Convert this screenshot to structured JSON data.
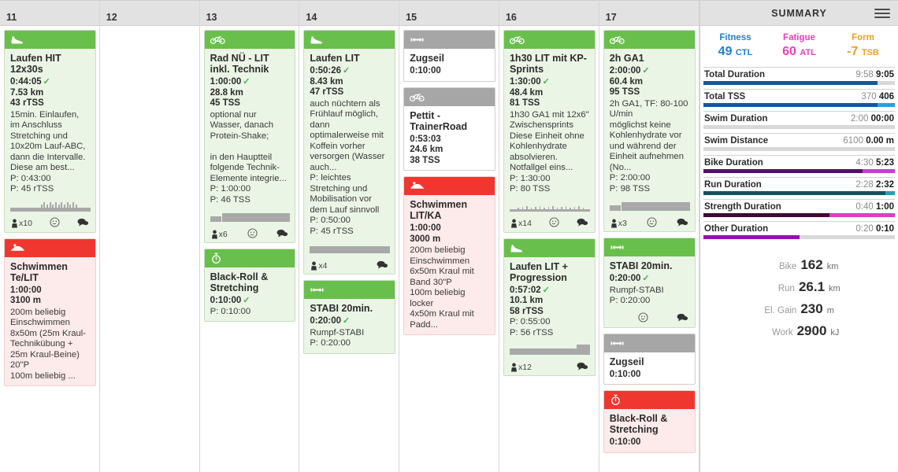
{
  "calendar": {
    "days": [
      {
        "label": "11",
        "cards": [
          {
            "icon": "running-shoe-icon",
            "color": "green",
            "title": "Laufen HIT 12x30s",
            "duration": "0:44:05",
            "completed": true,
            "distance": "7.53 km",
            "tss": "43 rTSS",
            "desc": "15min. Einlaufen, im Anschluss Stretching und 10x20m Lauf-ABC, dann die Intervalle. Diese am best...",
            "plan": [
              "P: 0:43:00",
              "P: 45 rTSS"
            ],
            "graph": "spikes",
            "foot": {
              "laps": "x10",
              "mood": true,
              "comment": true
            }
          },
          {
            "icon": "swim-icon",
            "color": "red",
            "title": "Schwimmen Te/LIT",
            "duration": "1:00:00",
            "completed": false,
            "distance": "3100 m",
            "tss": "",
            "desc": "200m beliebig Einschwimmen\n8x50m (25m Kraul-Technikübung + 25m Kraul-Beine) 20\"P\n100m beliebig ...",
            "plan": [],
            "graph": "",
            "foot": null
          }
        ]
      },
      {
        "label": "12",
        "cards": []
      },
      {
        "label": "13",
        "cards": [
          {
            "icon": "bike-icon",
            "color": "green",
            "title": "Rad NÜ - LIT inkl. Technik",
            "duration": "1:00:00",
            "completed": true,
            "distance": "28.8 km",
            "tss": "45 TSS",
            "desc": "optional nur Wasser, danach Protein-Shake;\n\nin den Hauptteil folgende Technik-Elemente integrie...",
            "plan": [
              "P: 1:00:00",
              "P: 46 TSS"
            ],
            "graph": "blocks",
            "foot": {
              "laps": "x6",
              "mood": true,
              "comment": true
            }
          },
          {
            "icon": "stopwatch-icon",
            "color": "green",
            "title": "Black-Roll & Stretching",
            "duration": "0:10:00",
            "completed": true,
            "distance": "",
            "tss": "",
            "desc": "",
            "plan": [
              "P: 0:10:00"
            ],
            "graph": "",
            "foot": null
          }
        ]
      },
      {
        "label": "14",
        "cards": [
          {
            "icon": "running-shoe-icon",
            "color": "green",
            "title": "Laufen LIT",
            "duration": "0:50:26",
            "completed": true,
            "distance": "8.43 km",
            "tss": "47 rTSS",
            "desc": "auch nüchtern als Frühlauf möglich, dann optimalerweise mit Koffein vorher versorgen (Wasser auch...",
            "plan": [
              "P: leichtes Stretching und Mobilisation vor dem Lauf sinnvoll",
              "P: 0:50:00",
              "P: 45 rTSS"
            ],
            "graph": "flat",
            "foot": {
              "laps": "x4",
              "mood": false,
              "comment": true
            }
          },
          {
            "icon": "stabi-icon",
            "color": "green",
            "title": "STABI 20min.",
            "duration": "0:20:00",
            "completed": true,
            "distance": "",
            "tss": "",
            "desc": "Rumpf-STABI",
            "plan": [
              "P: 0:20:00"
            ],
            "graph": "",
            "foot": null
          }
        ]
      },
      {
        "label": "15",
        "cards": [
          {
            "icon": "stabi-icon",
            "color": "gray",
            "title": "Zugseil",
            "duration": "0:10:00",
            "completed": false,
            "distance": "",
            "tss": "",
            "desc": "",
            "plan": [],
            "graph": "",
            "foot": null
          },
          {
            "icon": "bike-icon",
            "color": "gray",
            "title": "Pettit - TrainerRoad",
            "duration": "0:53:03",
            "completed": false,
            "distance": "24.6 km",
            "tss": "38 TSS",
            "desc": "",
            "plan": [],
            "graph": "",
            "foot": null
          },
          {
            "icon": "swim-icon",
            "color": "red",
            "title": "Schwimmen LIT/KA",
            "duration": "1:00:00",
            "completed": false,
            "distance": "3000 m",
            "tss": "",
            "desc": "200m beliebig Einschwimmen\n6x50m Kraul mit Band 30\"P\n100m beliebig locker\n4x50m Kraul mit Padd...",
            "plan": [],
            "graph": "",
            "foot": null
          }
        ]
      },
      {
        "label": "16",
        "cards": [
          {
            "icon": "bike-icon",
            "color": "green",
            "title": "1h30 LIT mit KP-Sprints",
            "duration": "1:30:00",
            "completed": true,
            "distance": "48.4 km",
            "tss": "81 TSS",
            "desc": "1h30 GA1 mit 12x6\" Zwischensprints\nDiese Einheit ohne Kohlenhydrate absolvieren. Notfallgel eins...",
            "plan": [
              "P: 1:30:00",
              "P: 80 TSS"
            ],
            "graph": "lowspikes",
            "foot": {
              "laps": "x14",
              "mood": true,
              "comment": true
            }
          },
          {
            "icon": "running-shoe-icon",
            "color": "green",
            "title": "Laufen LIT + Progression",
            "duration": "0:57:02",
            "completed": true,
            "distance": "10.1 km",
            "tss": "58 rTSS",
            "desc": "",
            "plan": [
              "P: 0:55:00",
              "P: 56 rTSS"
            ],
            "graph": "step",
            "foot": {
              "laps": "x12",
              "mood": false,
              "comment": true
            }
          }
        ]
      },
      {
        "label": "17",
        "cards": [
          {
            "icon": "bike-icon",
            "color": "green",
            "title": "2h GA1",
            "duration": "2:00:00",
            "completed": true,
            "distance": "60.4 km",
            "tss": "95 TSS",
            "desc": "2h GA1, TF: 80-100 U/min\nmöglichst keine Kohlenhydrate vor und während der Einheit aufnehmen (No...",
            "plan": [
              "P: 2:00:00",
              "P: 98 TSS"
            ],
            "graph": "blocks",
            "foot": {
              "laps": "x3",
              "mood": true,
              "comment": true
            }
          },
          {
            "icon": "stabi-icon",
            "color": "green",
            "title": "STABI 20min.",
            "duration": "0:20:00",
            "completed": true,
            "distance": "",
            "tss": "",
            "desc": "Rumpf-STABI",
            "plan": [
              "P: 0:20:00"
            ],
            "graph": "",
            "foot": {
              "laps": "",
              "mood": true,
              "comment": true
            }
          },
          {
            "icon": "stabi-icon",
            "color": "gray",
            "title": "Zugseil",
            "duration": "0:10:00",
            "completed": false,
            "distance": "",
            "tss": "",
            "desc": "",
            "plan": [],
            "graph": "",
            "foot": null
          },
          {
            "icon": "stopwatch-icon",
            "color": "red",
            "title": "Black-Roll & Stretching",
            "duration": "0:10:00",
            "completed": false,
            "distance": "",
            "tss": "",
            "desc": "",
            "plan": [],
            "graph": "",
            "foot": null
          }
        ]
      }
    ]
  },
  "summary": {
    "title": "SUMMARY",
    "menu_icon": "hamburger-icon",
    "pmc": [
      {
        "name": "Fitness",
        "value": "49",
        "unit": "CTL",
        "color": "#1f7fd4"
      },
      {
        "name": "Fatigue",
        "value": "60",
        "unit": "ATL",
        "color": "#ec3fc0"
      },
      {
        "name": "Form",
        "value": "-7",
        "unit": "TSB",
        "color": "#f0a01e"
      }
    ],
    "stats": [
      {
        "label": "Total Duration",
        "planned": "9:58",
        "actual": "9:05",
        "unit": "",
        "fill": 91,
        "fill2": 0,
        "color": "#13589e",
        "color2": "#d8d8d8"
      },
      {
        "label": "Total TSS",
        "planned": "370",
        "actual": "406",
        "unit": "",
        "fill": 91,
        "fill2": 9,
        "color": "#13589e",
        "color2": "#2f9ede"
      },
      {
        "label": "Swim Duration",
        "planned": "2:00",
        "actual": "00:00",
        "unit": "",
        "fill": 0,
        "fill2": 0,
        "color": "#bdbdbd",
        "color2": "#d8d8d8"
      },
      {
        "label": "Swim Distance",
        "planned": "6100",
        "actual": "0.00 m",
        "unit": "",
        "fill": 0,
        "fill2": 0,
        "color": "#bdbdbd",
        "color2": "#d8d8d8"
      },
      {
        "label": "Bike Duration",
        "planned": "4:30",
        "actual": "5:23",
        "unit": "",
        "fill": 83,
        "fill2": 17,
        "color": "#51106b",
        "color2": "#c13fd6"
      },
      {
        "label": "Run Duration",
        "planned": "2:28",
        "actual": "2:32",
        "unit": "",
        "fill": 95,
        "fill2": 5,
        "color": "#16515e",
        "color2": "#2a9fb5"
      },
      {
        "label": "Strength Duration",
        "planned": "0:40",
        "actual": "1:00",
        "unit": "",
        "fill": 66,
        "fill2": 34,
        "color": "#3d0b33",
        "color2": "#e03ec0"
      },
      {
        "label": "Other Duration",
        "planned": "0:20",
        "actual": "0:10",
        "unit": "",
        "fill": 50,
        "fill2": 0,
        "color": "#9510b5",
        "color2": "#d8d8d8"
      }
    ],
    "totals": [
      {
        "label": "Bike",
        "value": "162",
        "unit": "km"
      },
      {
        "label": "Run",
        "value": "26.1",
        "unit": "km"
      },
      {
        "label": "El. Gain",
        "value": "230",
        "unit": "m"
      },
      {
        "label": "Work",
        "value": "2900",
        "unit": "kJ"
      }
    ]
  }
}
